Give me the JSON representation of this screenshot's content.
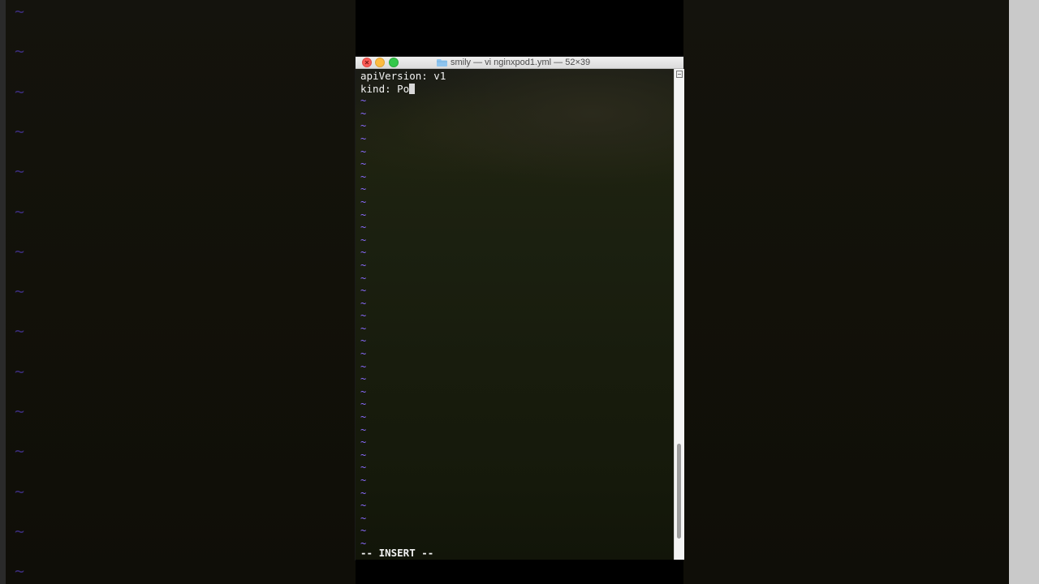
{
  "window": {
    "title": "smily — vi nginxpod1.yml — 52×39"
  },
  "editor": {
    "lines": [
      "apiVersion: v1",
      "kind: Po"
    ],
    "empty_line_marker": "~",
    "status": "-- INSERT --",
    "mode": "insert"
  },
  "scrollbar": {
    "position_fraction": 0.9,
    "visible_fraction": 0.1
  },
  "colors": {
    "tilde": "#8a6bff",
    "close_button": "#fc5b57",
    "minimize_button": "#fdbc40",
    "maximize_button": "#34c84a",
    "text": "#f2f2f2"
  },
  "icons": {
    "title_icon": "folder-icon",
    "close": "close-icon",
    "minimize": "minimize-icon",
    "maximize": "maximize-icon"
  }
}
